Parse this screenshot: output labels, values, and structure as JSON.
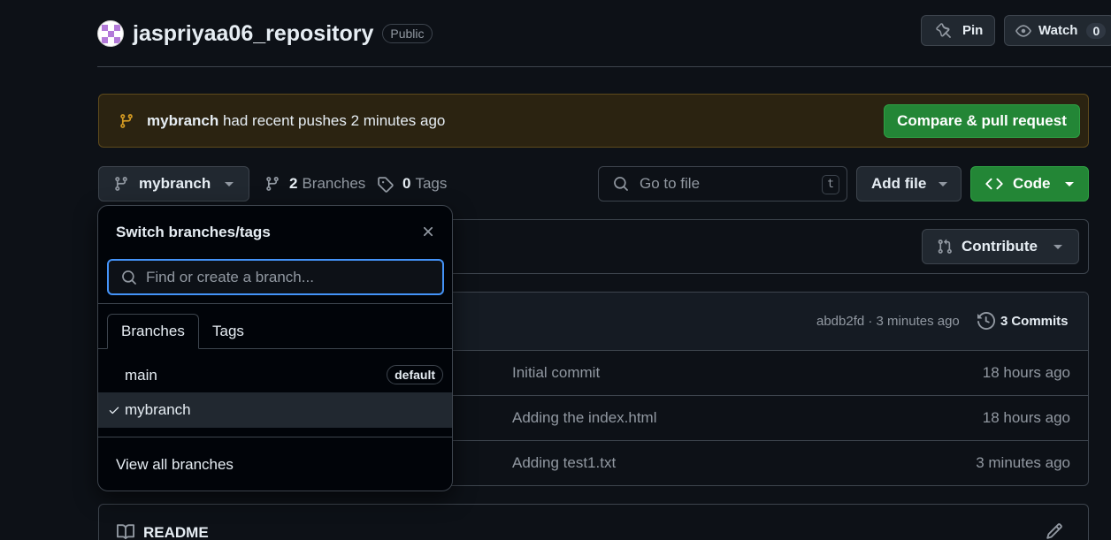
{
  "repo": {
    "name": "jaspriyaa06_repository",
    "visibility": "Public",
    "pin_label": "Pin",
    "watch_label": "Watch",
    "watch_count": "0"
  },
  "banner": {
    "branch": "mybranch",
    "text": " had recent pushes 2 minutes ago",
    "button_label": "Compare & pull request"
  },
  "branch_bar": {
    "current_branch": "mybranch",
    "branch_count": "2",
    "branches_label": "Branches",
    "tag_count": "0",
    "tags_label": "Tags",
    "search_placeholder": "Go to file",
    "search_shortcut": "t",
    "add_file_label": "Add file",
    "code_label": "Code"
  },
  "contribute": {
    "label": "Contribute"
  },
  "latest_commit": {
    "hash_time": "abdb2fd · 3 minutes ago",
    "commits_count": "3",
    "commits_label": "Commits"
  },
  "files": [
    {
      "message": "Initial commit",
      "time": "18 hours ago"
    },
    {
      "message": "Adding the index.html",
      "time": "18 hours ago"
    },
    {
      "message": "Adding test1.txt",
      "time": "3 minutes ago"
    }
  ],
  "readme": {
    "label": "README"
  },
  "dropdown": {
    "title": "Switch branches/tags",
    "input_placeholder": "Find or create a branch...",
    "tabs": [
      "Branches",
      "Tags"
    ],
    "branches": [
      {
        "name": "main",
        "badge": "default",
        "selected": false
      },
      {
        "name": "mybranch",
        "badge": "",
        "selected": true
      }
    ],
    "footer_link": "View all branches"
  },
  "colors": {
    "background": "#0d1117",
    "accent_green": "#238636",
    "focus_blue": "#4493f8",
    "banner_bg": "#2b2311",
    "branch_icon_yellow": "#d29922"
  }
}
